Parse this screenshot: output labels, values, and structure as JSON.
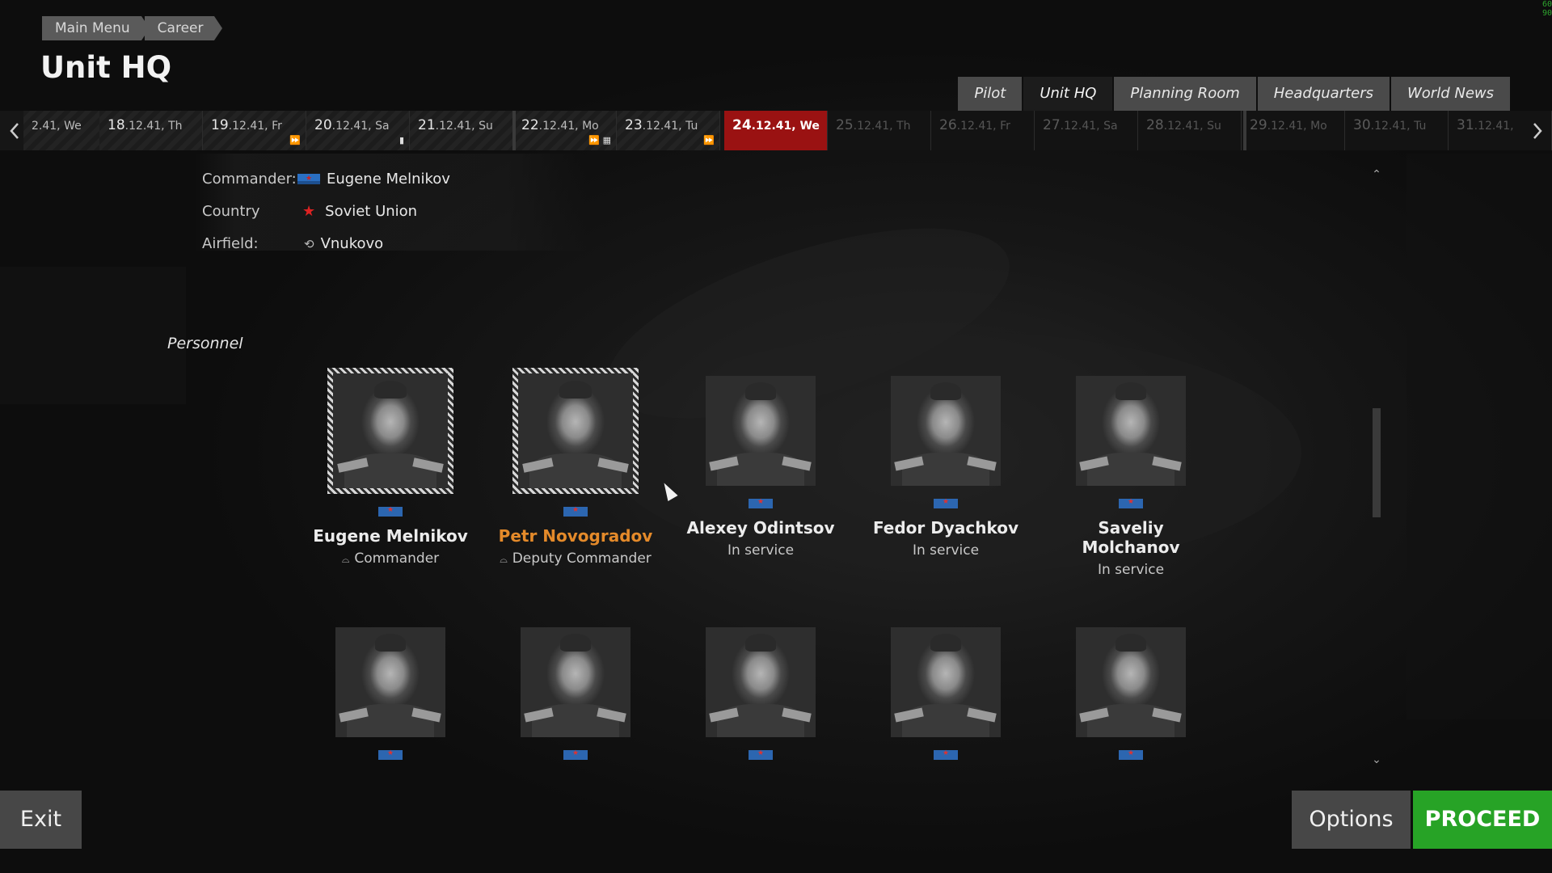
{
  "breadcrumb": [
    "Main Menu",
    "Career"
  ],
  "page_title": "Unit HQ",
  "tabs": [
    {
      "label": "Pilot",
      "active": false
    },
    {
      "label": "Unit HQ",
      "active": true
    },
    {
      "label": "Planning Room",
      "active": false
    },
    {
      "label": "Headquarters",
      "active": false
    },
    {
      "label": "World News",
      "active": false
    }
  ],
  "timeline": [
    {
      "d": "",
      "rest": "2.41, We",
      "state": "past"
    },
    {
      "d": "18",
      "rest": ".12.41, Th",
      "state": "past"
    },
    {
      "d": "19",
      "rest": ".12.41, Fr",
      "state": "past",
      "mark": "⏩"
    },
    {
      "d": "20",
      "rest": ".12.41, Sa",
      "state": "past",
      "mark": "▮"
    },
    {
      "d": "21",
      "rest": ".12.41, Su",
      "state": "past"
    },
    {
      "d": "22",
      "rest": ".12.41, Mo",
      "state": "past",
      "mark": "⏩ ▦"
    },
    {
      "d": "23",
      "rest": ".12.41, Tu",
      "state": "past",
      "mark": "⏩"
    },
    {
      "d": "24",
      "rest": ".12.41, We",
      "state": "current"
    },
    {
      "d": "25",
      "rest": ".12.41, Th",
      "state": "future"
    },
    {
      "d": "26",
      "rest": ".12.41, Fr",
      "state": "future"
    },
    {
      "d": "27",
      "rest": ".12.41, Sa",
      "state": "future"
    },
    {
      "d": "28",
      "rest": ".12.41, Su",
      "state": "future"
    },
    {
      "d": "29",
      "rest": ".12.41, Mo",
      "state": "future"
    },
    {
      "d": "30",
      "rest": ".12.41, Tu",
      "state": "future"
    },
    {
      "d": "31",
      "rest": ".12.41,",
      "state": "future"
    }
  ],
  "info": {
    "commander_label": "Commander:",
    "commander_value": "Eugene Melnikov",
    "country_label": "Country",
    "country_value": "Soviet Union",
    "airfield_label": "Airfield:",
    "airfield_value": "Vnukovo"
  },
  "personnel_title": "Personnel",
  "personnel": [
    {
      "name": "Eugene Melnikov",
      "role": "Commander",
      "framed": true,
      "selected": false,
      "cap": true
    },
    {
      "name": "Petr Novogradov",
      "role": "Deputy Commander",
      "framed": true,
      "selected": true,
      "cap": true
    },
    {
      "name": "Alexey Odintsov",
      "role": "In service",
      "framed": false,
      "selected": false,
      "cap": false
    },
    {
      "name": "Fedor Dyachkov",
      "role": "In service",
      "framed": false,
      "selected": false,
      "cap": false
    },
    {
      "name": "Saveliy Molchanov",
      "role": "In service",
      "framed": false,
      "selected": false,
      "cap": false
    },
    {
      "name": "",
      "role": "",
      "framed": false,
      "selected": false,
      "cap": false
    },
    {
      "name": "",
      "role": "",
      "framed": false,
      "selected": false,
      "cap": false
    },
    {
      "name": "",
      "role": "",
      "framed": false,
      "selected": false,
      "cap": false
    },
    {
      "name": "",
      "role": "",
      "framed": false,
      "selected": false,
      "cap": false
    },
    {
      "name": "",
      "role": "",
      "framed": false,
      "selected": false,
      "cap": false
    }
  ],
  "buttons": {
    "exit": "Exit",
    "options": "Options",
    "proceed": "PROCEED"
  },
  "fps_readout": [
    "60",
    "90"
  ],
  "colors": {
    "current_day": "#9a1212",
    "proceed": "#27a326",
    "selected_name": "#e48a2a"
  },
  "icons": {
    "timeline_left": "chevron-left-icon",
    "timeline_right": "chevron-right-icon",
    "country": "red-star-icon",
    "airfield": "airfield-icon",
    "role": "officer-cap-icon"
  }
}
